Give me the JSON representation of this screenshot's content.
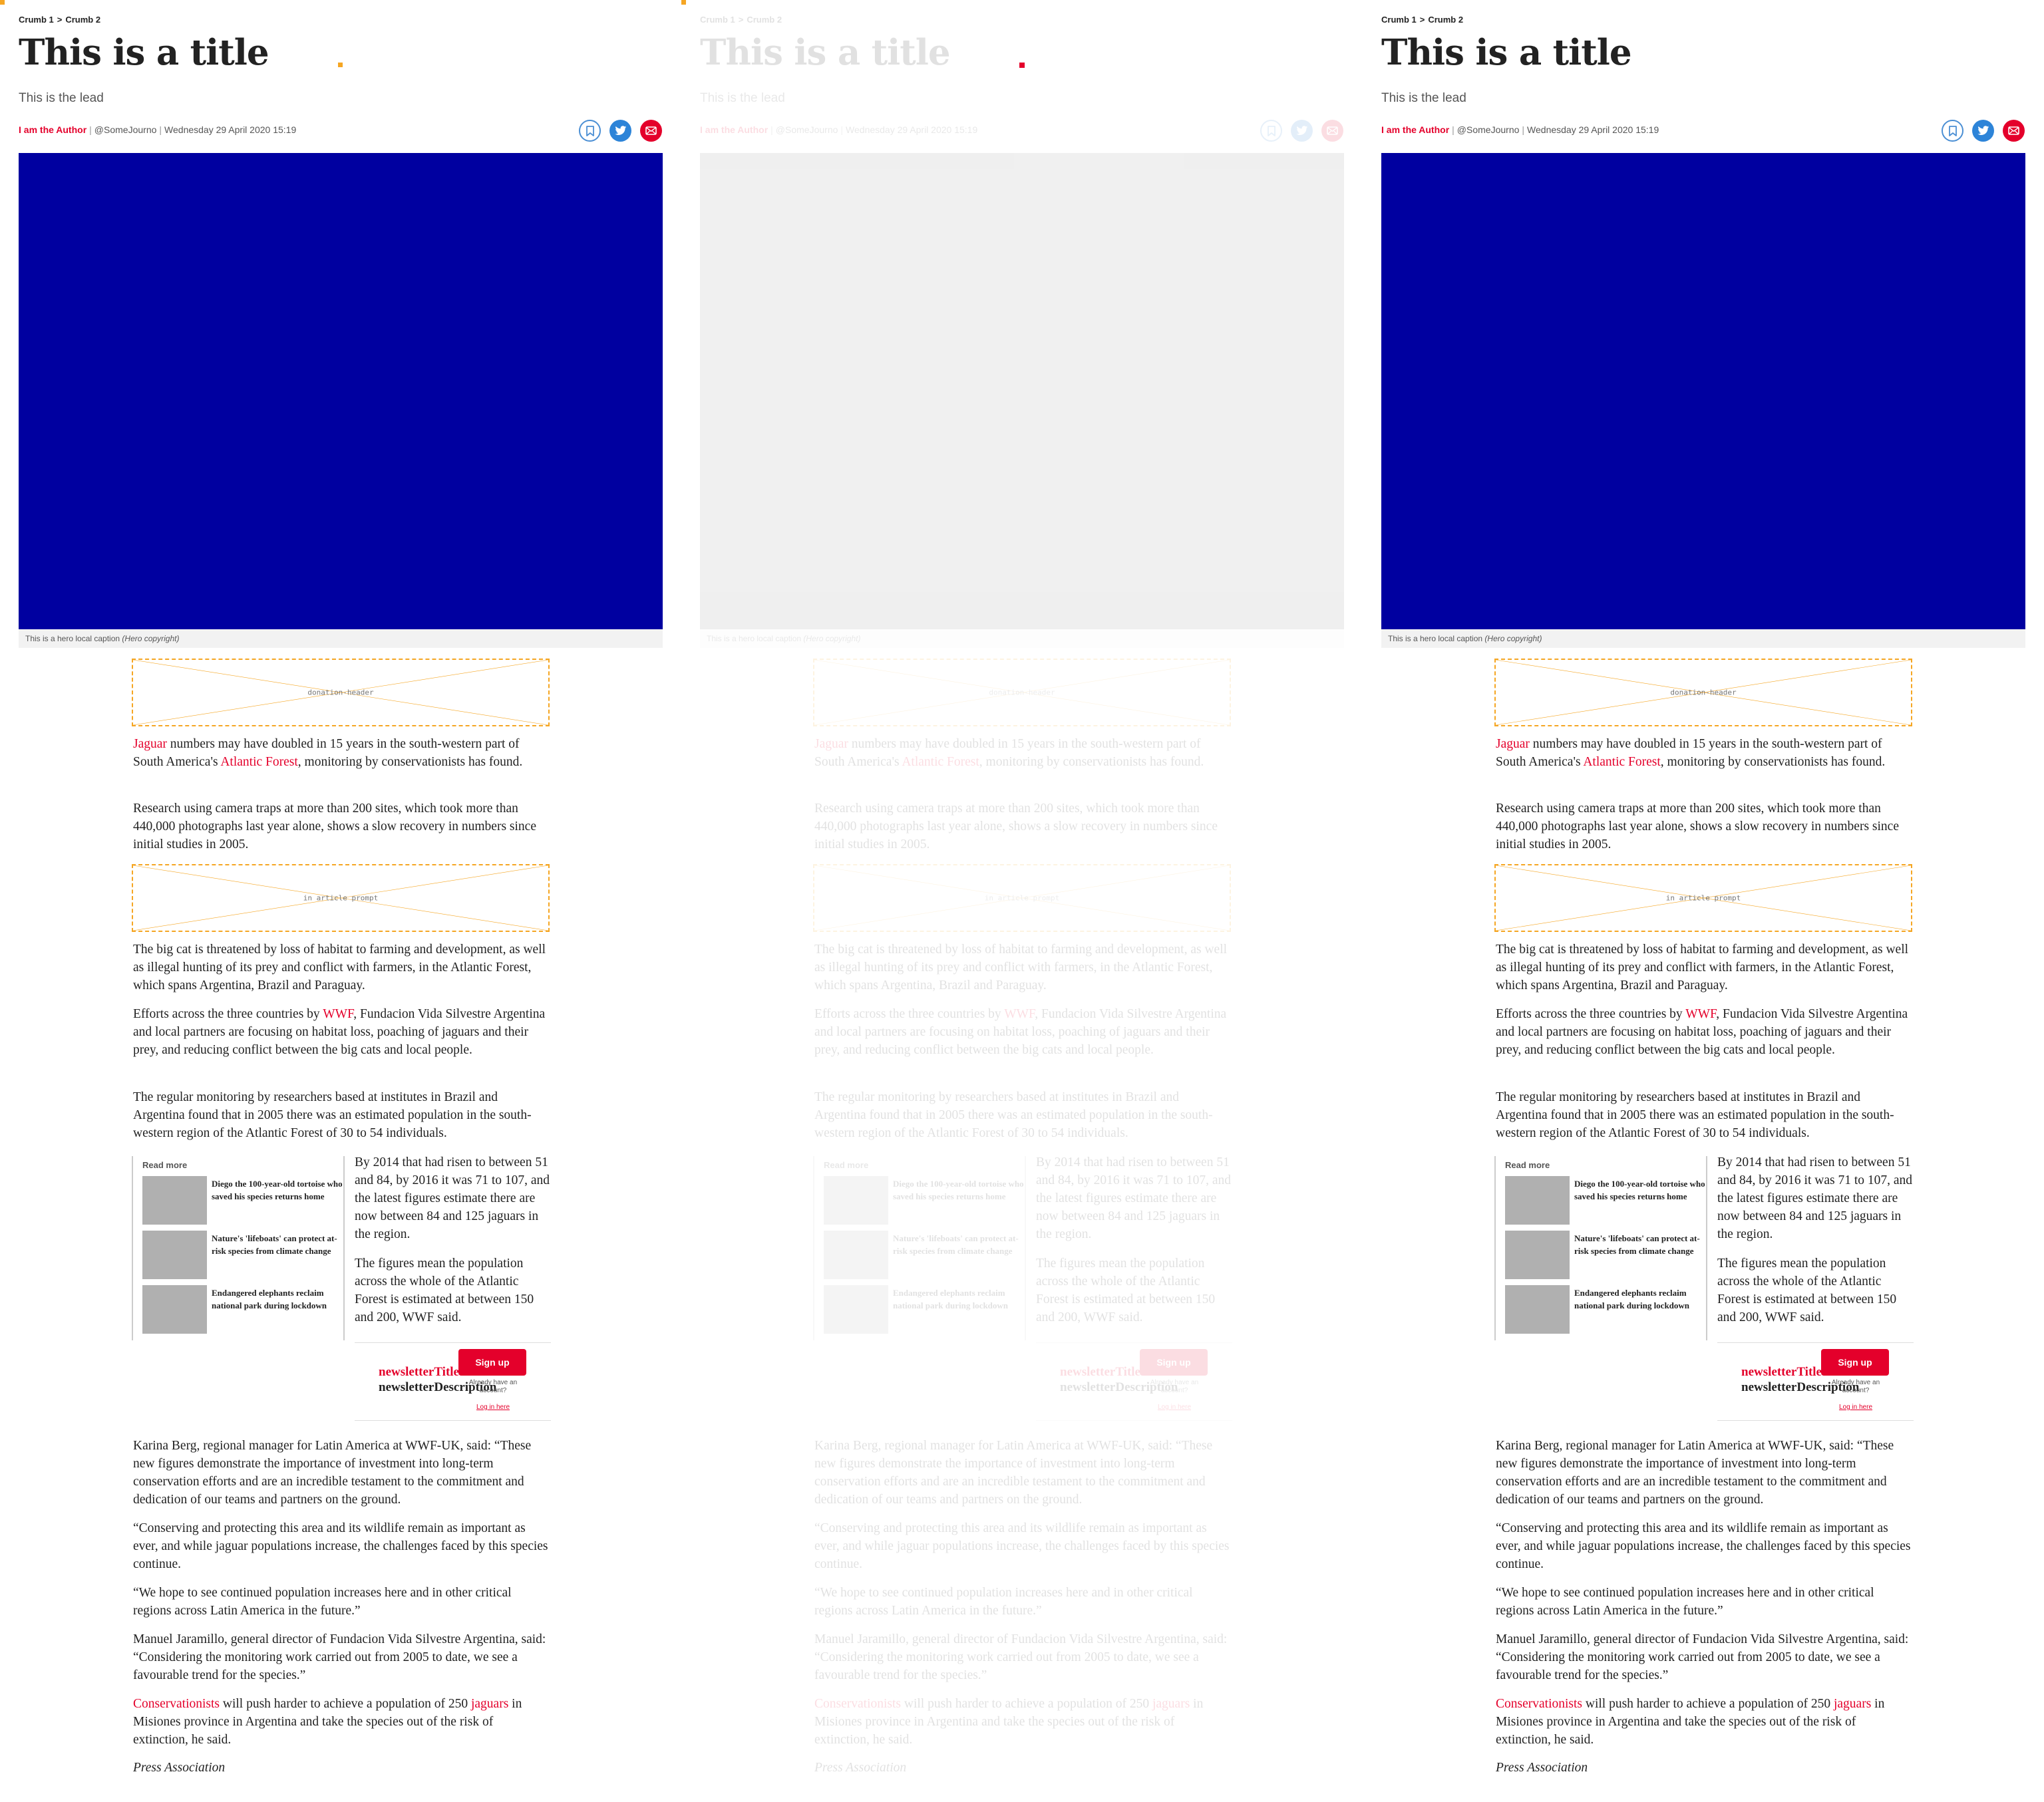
{
  "breadcrumbs": [
    "Crumb 1",
    "Crumb 2"
  ],
  "breadcrumb_separator": ">",
  "article": {
    "title": "This is a title",
    "lead": "This is the lead",
    "author": "I am the Author",
    "handle": "@SomeJourno",
    "date": "Wednesday 29 April 2020 15:19",
    "hero_caption": "This is a hero local caption",
    "hero_copyright": "(Hero copyright)",
    "hero_color": "#0000a0"
  },
  "share_icons": [
    "bookmark-icon",
    "twitter-icon",
    "email-icon"
  ],
  "placeholders": {
    "donation_header": "donation-header",
    "in_article_prompt": "in article prompt"
  },
  "paragraphs": {
    "p1": {
      "link1": "Jaguar",
      "text1": " numbers may have doubled in 15 years in the south-western part of South America's ",
      "link2": "Atlantic Forest",
      "text2": ", monitoring by conservationists has found."
    },
    "p2": "Research using camera traps at more than 200 sites, which took more than 440,000 photographs last year alone, shows a slow recovery in numbers since initial studies in 2005.",
    "p3": "The big cat is threatened by loss of habitat to farming and development, as well as illegal hunting of its prey and conflict with farmers, in the Atlantic Forest, which spans Argentina, Brazil and Paraguay.",
    "p4": {
      "text1": "Efforts across the three countries by ",
      "link1": "WWF",
      "text2": ", Fundacion Vida Silvestre Argentina and local partners are focusing on habitat loss, poaching of jaguars and their prey, and reducing conflict between the big cats and local people."
    },
    "p5": "The regular monitoring by researchers based at institutes in Brazil and Argentina found that in 2005 there was an estimated population in the south-western region of the Atlantic Forest of 30 to 54 individuals.",
    "p6": "By 2014 that had risen to between 51 and 84, by 2016 it was 71 to 107, and the latest figures estimate there are now between 84 and 125 jaguars in the region.",
    "p7": "The figures mean the population across the whole of the Atlantic Forest is estimated at between 150 and 200, WWF said.",
    "p8": "Karina Berg, regional manager for Latin America at WWF-UK, said: “These new figures demonstrate the importance of investment into long-term conservation efforts and are an incredible testament to the commitment and dedication of our teams and partners on the ground.",
    "p9": "“Conserving and protecting this area and its wildlife remain as important as ever, and while jaguar populations increase, the challenges faced by this species continue.",
    "p10": "“We hope to see continued population increases here and in other critical regions across Latin America in the future.”",
    "p11": "Manuel Jaramillo, general director of Fundacion Vida Silvestre Argentina, said: “Considering the monitoring work carried out from 2005 to date, we see a favourable trend for the species.”",
    "p12": {
      "link1": "Conservationists",
      "text1": " will push harder to achieve a population of 250 ",
      "link2": "jaguars",
      "text2": " in Misiones province in Argentina and take the species out of the risk of extinction, he said."
    },
    "signature": "Press Association"
  },
  "read_more": {
    "heading": "Read more",
    "items": [
      {
        "title": "Diego the 100-year-old tortoise who saved his species returns home"
      },
      {
        "title": "Nature's 'lifeboats' can protect at-risk species from climate change"
      },
      {
        "title": "Endangered elephants reclaim national park during lockdown"
      }
    ]
  },
  "newsletter": {
    "title": "newsletterTitle",
    "description": "newsletterDescription",
    "signup": "Sign up",
    "already": "Already have an account?",
    "login": "Log in here"
  },
  "colors": {
    "accent": "#e4002b",
    "twitter": "#2d84d8",
    "placeholder_border": "#f5a623"
  }
}
